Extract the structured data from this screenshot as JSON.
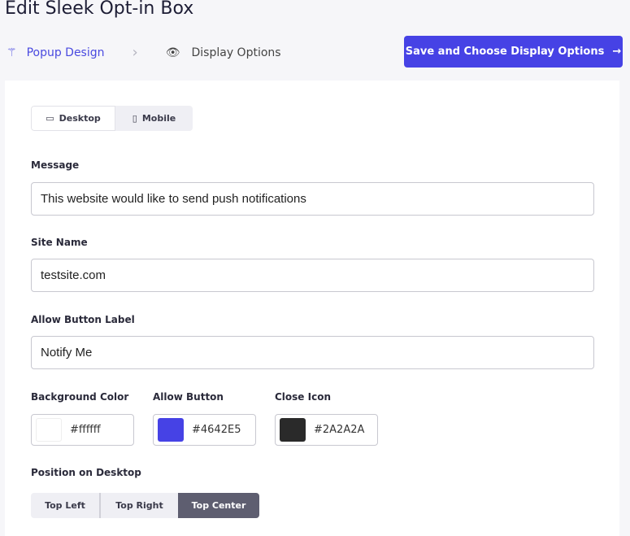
{
  "title": "Edit Sleek Opt-in Box",
  "steps": [
    {
      "label": "Popup Design",
      "icon": "magic-wand-icon"
    },
    {
      "label": "Display Options",
      "icon": "eye-icon"
    }
  ],
  "save_label": "Save and Choose Display Options",
  "devices": [
    "Desktop",
    "Mobile"
  ],
  "fields": {
    "message": {
      "label": "Message",
      "value": "This website would like to send push notifications"
    },
    "site_name": {
      "label": "Site Name",
      "value": "testsite.com"
    },
    "allow_label": {
      "label": "Allow Button Label",
      "value": "Notify Me"
    }
  },
  "colors": [
    {
      "label": "Background Color",
      "value": "#ffffff"
    },
    {
      "label": "Allow Button",
      "value": "#4642E5"
    },
    {
      "label": "Close Icon",
      "value": "#2A2A2A"
    }
  ],
  "position": {
    "label": "Position on Desktop",
    "options": [
      "Top Left",
      "Top Right",
      "Top Center"
    ],
    "selected": "Top Center"
  }
}
